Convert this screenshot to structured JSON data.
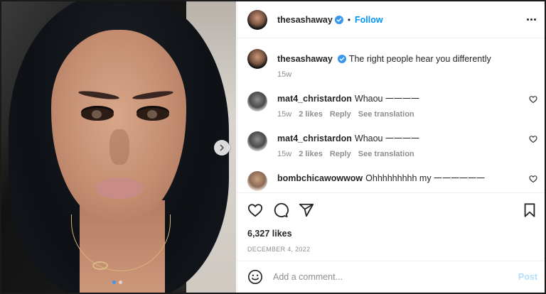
{
  "post": {
    "author": "thesasha­way",
    "follow_label": "Follow",
    "dot": "•",
    "caption": {
      "username": "thesashaway",
      "text": "The right people hear you differently",
      "age": "15w"
    },
    "comments": [
      {
        "username": "mat4_christardon",
        "text": "Whaou 𑁋𑁋𑁋𑁋",
        "age": "15w",
        "likes": "2 likes",
        "reply": "Reply",
        "translate": "See translation"
      },
      {
        "username": "mat4_christardon",
        "text": "Whaou 𑁋𑁋𑁋𑁋",
        "age": "15w",
        "likes": "2 likes",
        "reply": "Reply",
        "translate": "See translation"
      },
      {
        "username": "bombchicawowwow",
        "text": "Ohhhhhhhhh my 𑁋𑁋𑁋𑁋𑁋𑁋",
        "age": "",
        "likes": "",
        "reply": "",
        "translate": ""
      }
    ],
    "likes_count": "6,327 likes",
    "date": "DECEMBER 4, 2022",
    "add_comment_placeholder": "Add a comment...",
    "post_label": "Post"
  },
  "colors": {
    "link": "#0095f6",
    "post_disabled": "#b2dffc",
    "muted": "#8e8e8e"
  },
  "icons": [
    "verified-icon",
    "more-icon",
    "heart-icon",
    "comment-icon",
    "share-icon",
    "bookmark-icon",
    "emoji-icon",
    "chevron-right-icon"
  ]
}
